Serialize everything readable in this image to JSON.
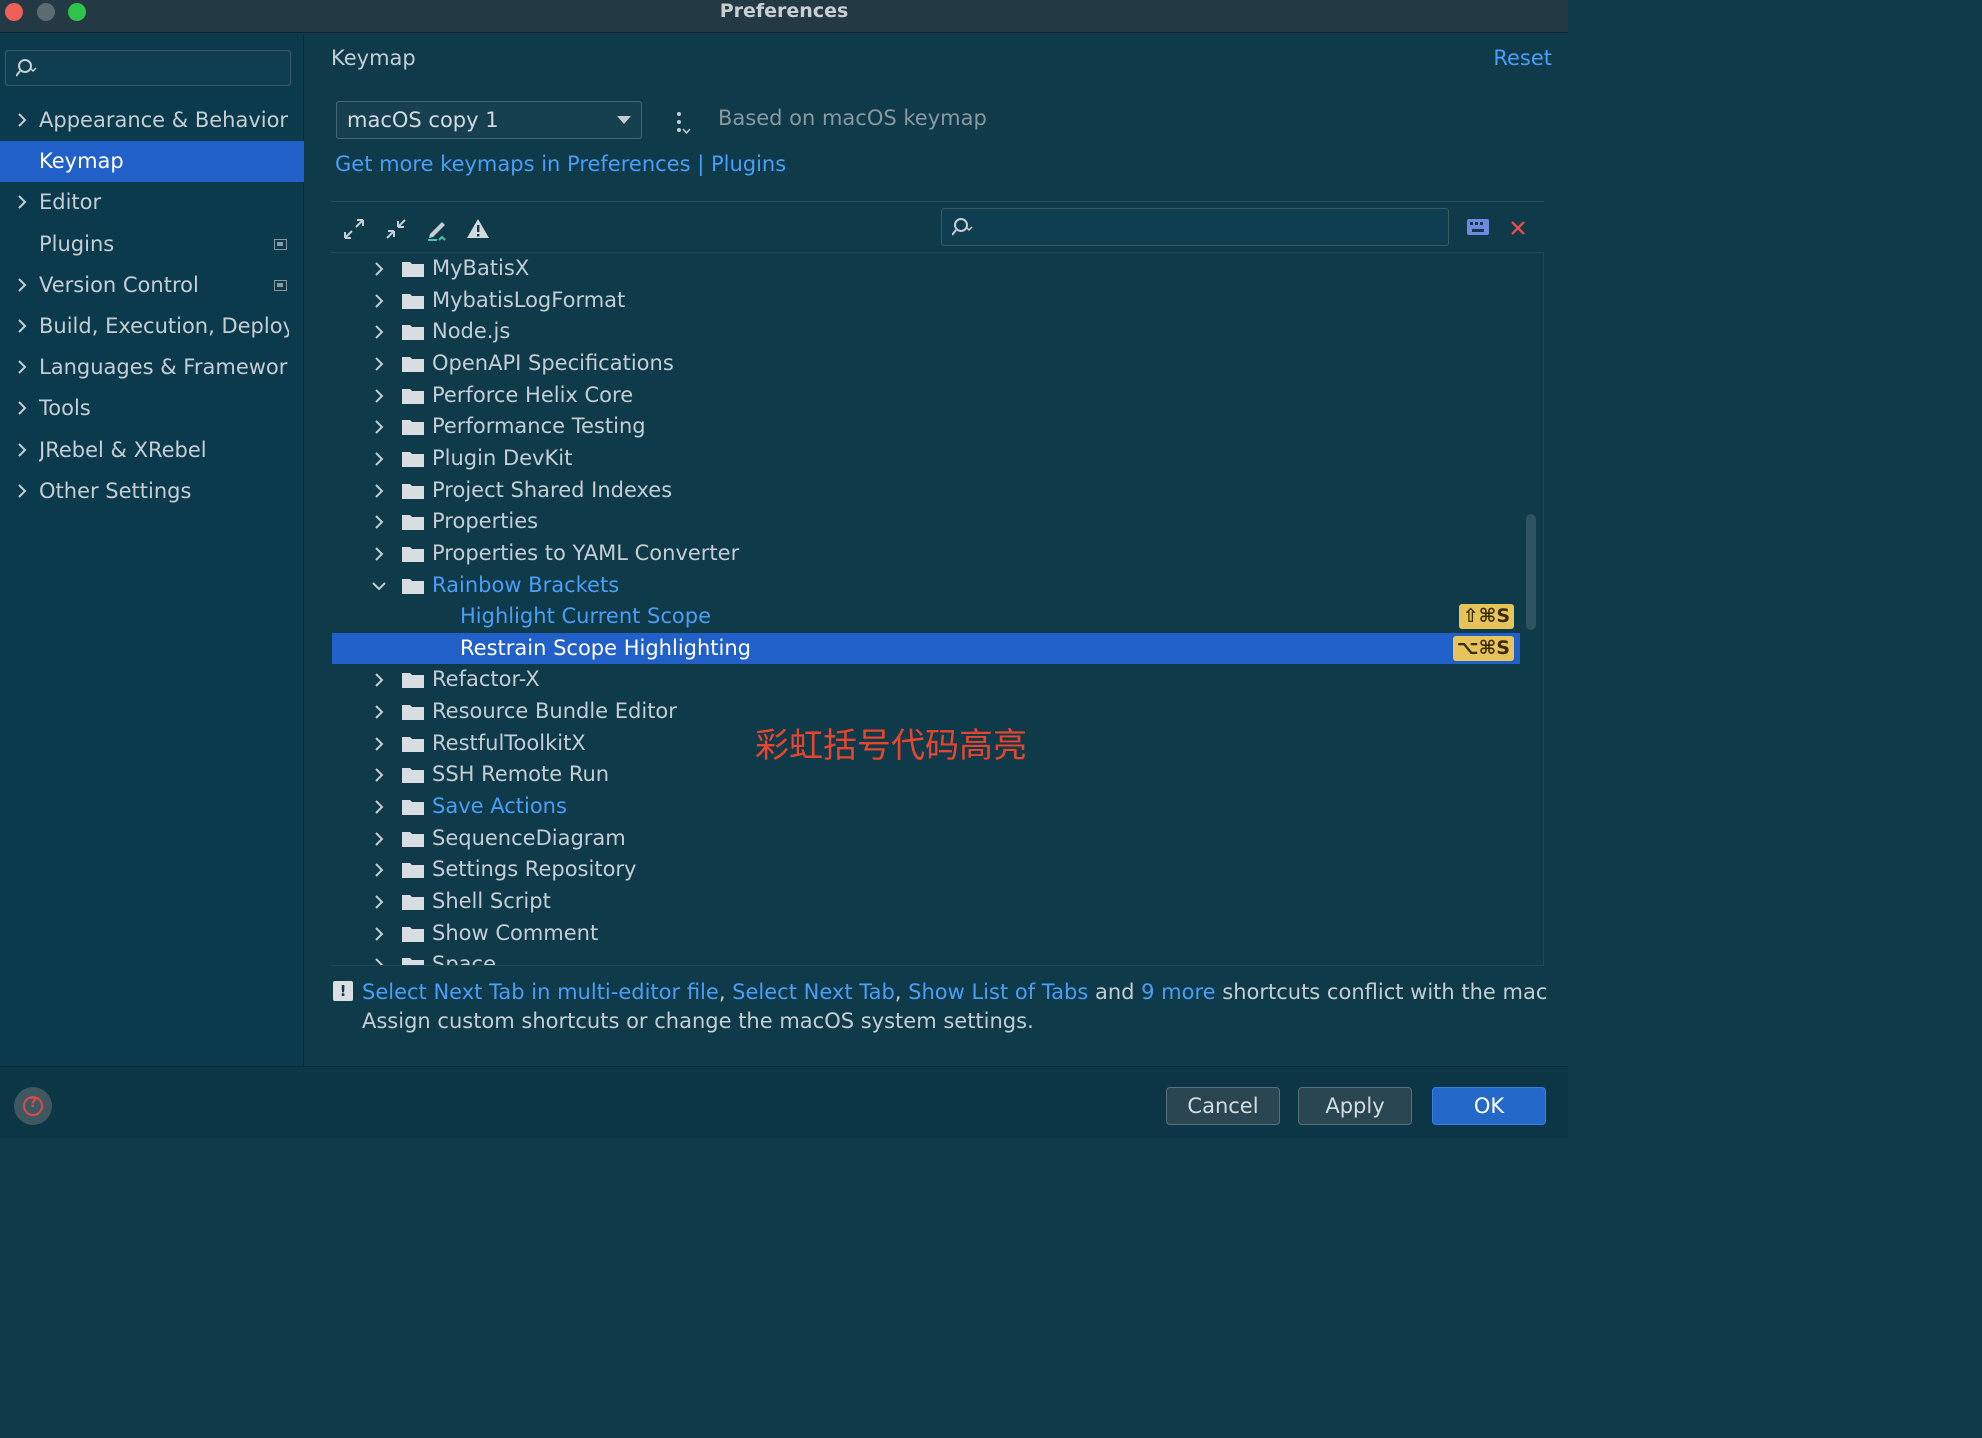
{
  "window": {
    "title": "Preferences"
  },
  "sidebar": {
    "items": [
      {
        "label": "Appearance & Behavior",
        "expandable": true
      },
      {
        "label": "Keymap",
        "expandable": false,
        "selected": true
      },
      {
        "label": "Editor",
        "expandable": true
      },
      {
        "label": "Plugins",
        "expandable": false,
        "badge": true
      },
      {
        "label": "Version Control",
        "expandable": true,
        "badge": true
      },
      {
        "label": "Build, Execution, Deployment",
        "expandable": true
      },
      {
        "label": "Languages & Frameworks",
        "expandable": true
      },
      {
        "label": "Tools",
        "expandable": true
      },
      {
        "label": "JRebel & XRebel",
        "expandable": true
      },
      {
        "label": "Other Settings",
        "expandable": true
      }
    ]
  },
  "header": {
    "breadcrumb": "Keymap",
    "reset_label": "Reset"
  },
  "keymap": {
    "selected": "macOS copy 1",
    "based_on": "Based on macOS keymap",
    "get_more_link": "Get more keymaps in Preferences | Plugins"
  },
  "tree": {
    "rows": [
      {
        "label": "MyBatisX",
        "level": 0,
        "expanded": false
      },
      {
        "label": "MybatisLogFormat",
        "level": 0,
        "expanded": false
      },
      {
        "label": "Node.js",
        "level": 0,
        "expanded": false
      },
      {
        "label": "OpenAPI Specifications",
        "level": 0,
        "expanded": false
      },
      {
        "label": "Perforce Helix Core",
        "level": 0,
        "expanded": false
      },
      {
        "label": "Performance Testing",
        "level": 0,
        "expanded": false
      },
      {
        "label": "Plugin DevKit",
        "level": 0,
        "expanded": false
      },
      {
        "label": "Project Shared Indexes",
        "level": 0,
        "expanded": false
      },
      {
        "label": "Properties",
        "level": 0,
        "expanded": false
      },
      {
        "label": "Properties to YAML Converter",
        "level": 0,
        "expanded": false
      },
      {
        "label": "Rainbow Brackets",
        "level": 0,
        "expanded": true,
        "link": true
      },
      {
        "label": "Highlight Current Scope",
        "level": 1,
        "link": true,
        "shortcut": "⇧⌘S"
      },
      {
        "label": "Restrain Scope Highlighting",
        "level": 1,
        "selected": true,
        "shortcut": "⌥⌘S"
      },
      {
        "label": "Refactor-X",
        "level": 0,
        "expanded": false
      },
      {
        "label": "Resource Bundle Editor",
        "level": 0,
        "expanded": false
      },
      {
        "label": "RestfulToolkitX",
        "level": 0,
        "expanded": false
      },
      {
        "label": "SSH Remote Run",
        "level": 0,
        "expanded": false
      },
      {
        "label": "Save Actions",
        "level": 0,
        "expanded": false,
        "link": true
      },
      {
        "label": "SequenceDiagram",
        "level": 0,
        "expanded": false
      },
      {
        "label": "Settings Repository",
        "level": 0,
        "expanded": false
      },
      {
        "label": "Shell Script",
        "level": 0,
        "expanded": false
      },
      {
        "label": "Show Comment",
        "level": 0,
        "expanded": false
      },
      {
        "label": "Space",
        "level": 0,
        "expanded": false
      }
    ]
  },
  "annotation": "彩虹括号代码高亮",
  "notice": {
    "link1": "Select Next Tab in multi-editor file",
    "sep1": ", ",
    "link2": "Select Next Tab",
    "sep2": ", ",
    "link3": "Show List of Tabs",
    "and": " and ",
    "link4": "9 more",
    "tail": " shortcuts conflict with the macOS system shortcuts.",
    "line2": "Assign custom shortcuts or change the macOS system settings."
  },
  "footer": {
    "cancel": "Cancel",
    "apply": "Apply",
    "ok": "OK"
  }
}
